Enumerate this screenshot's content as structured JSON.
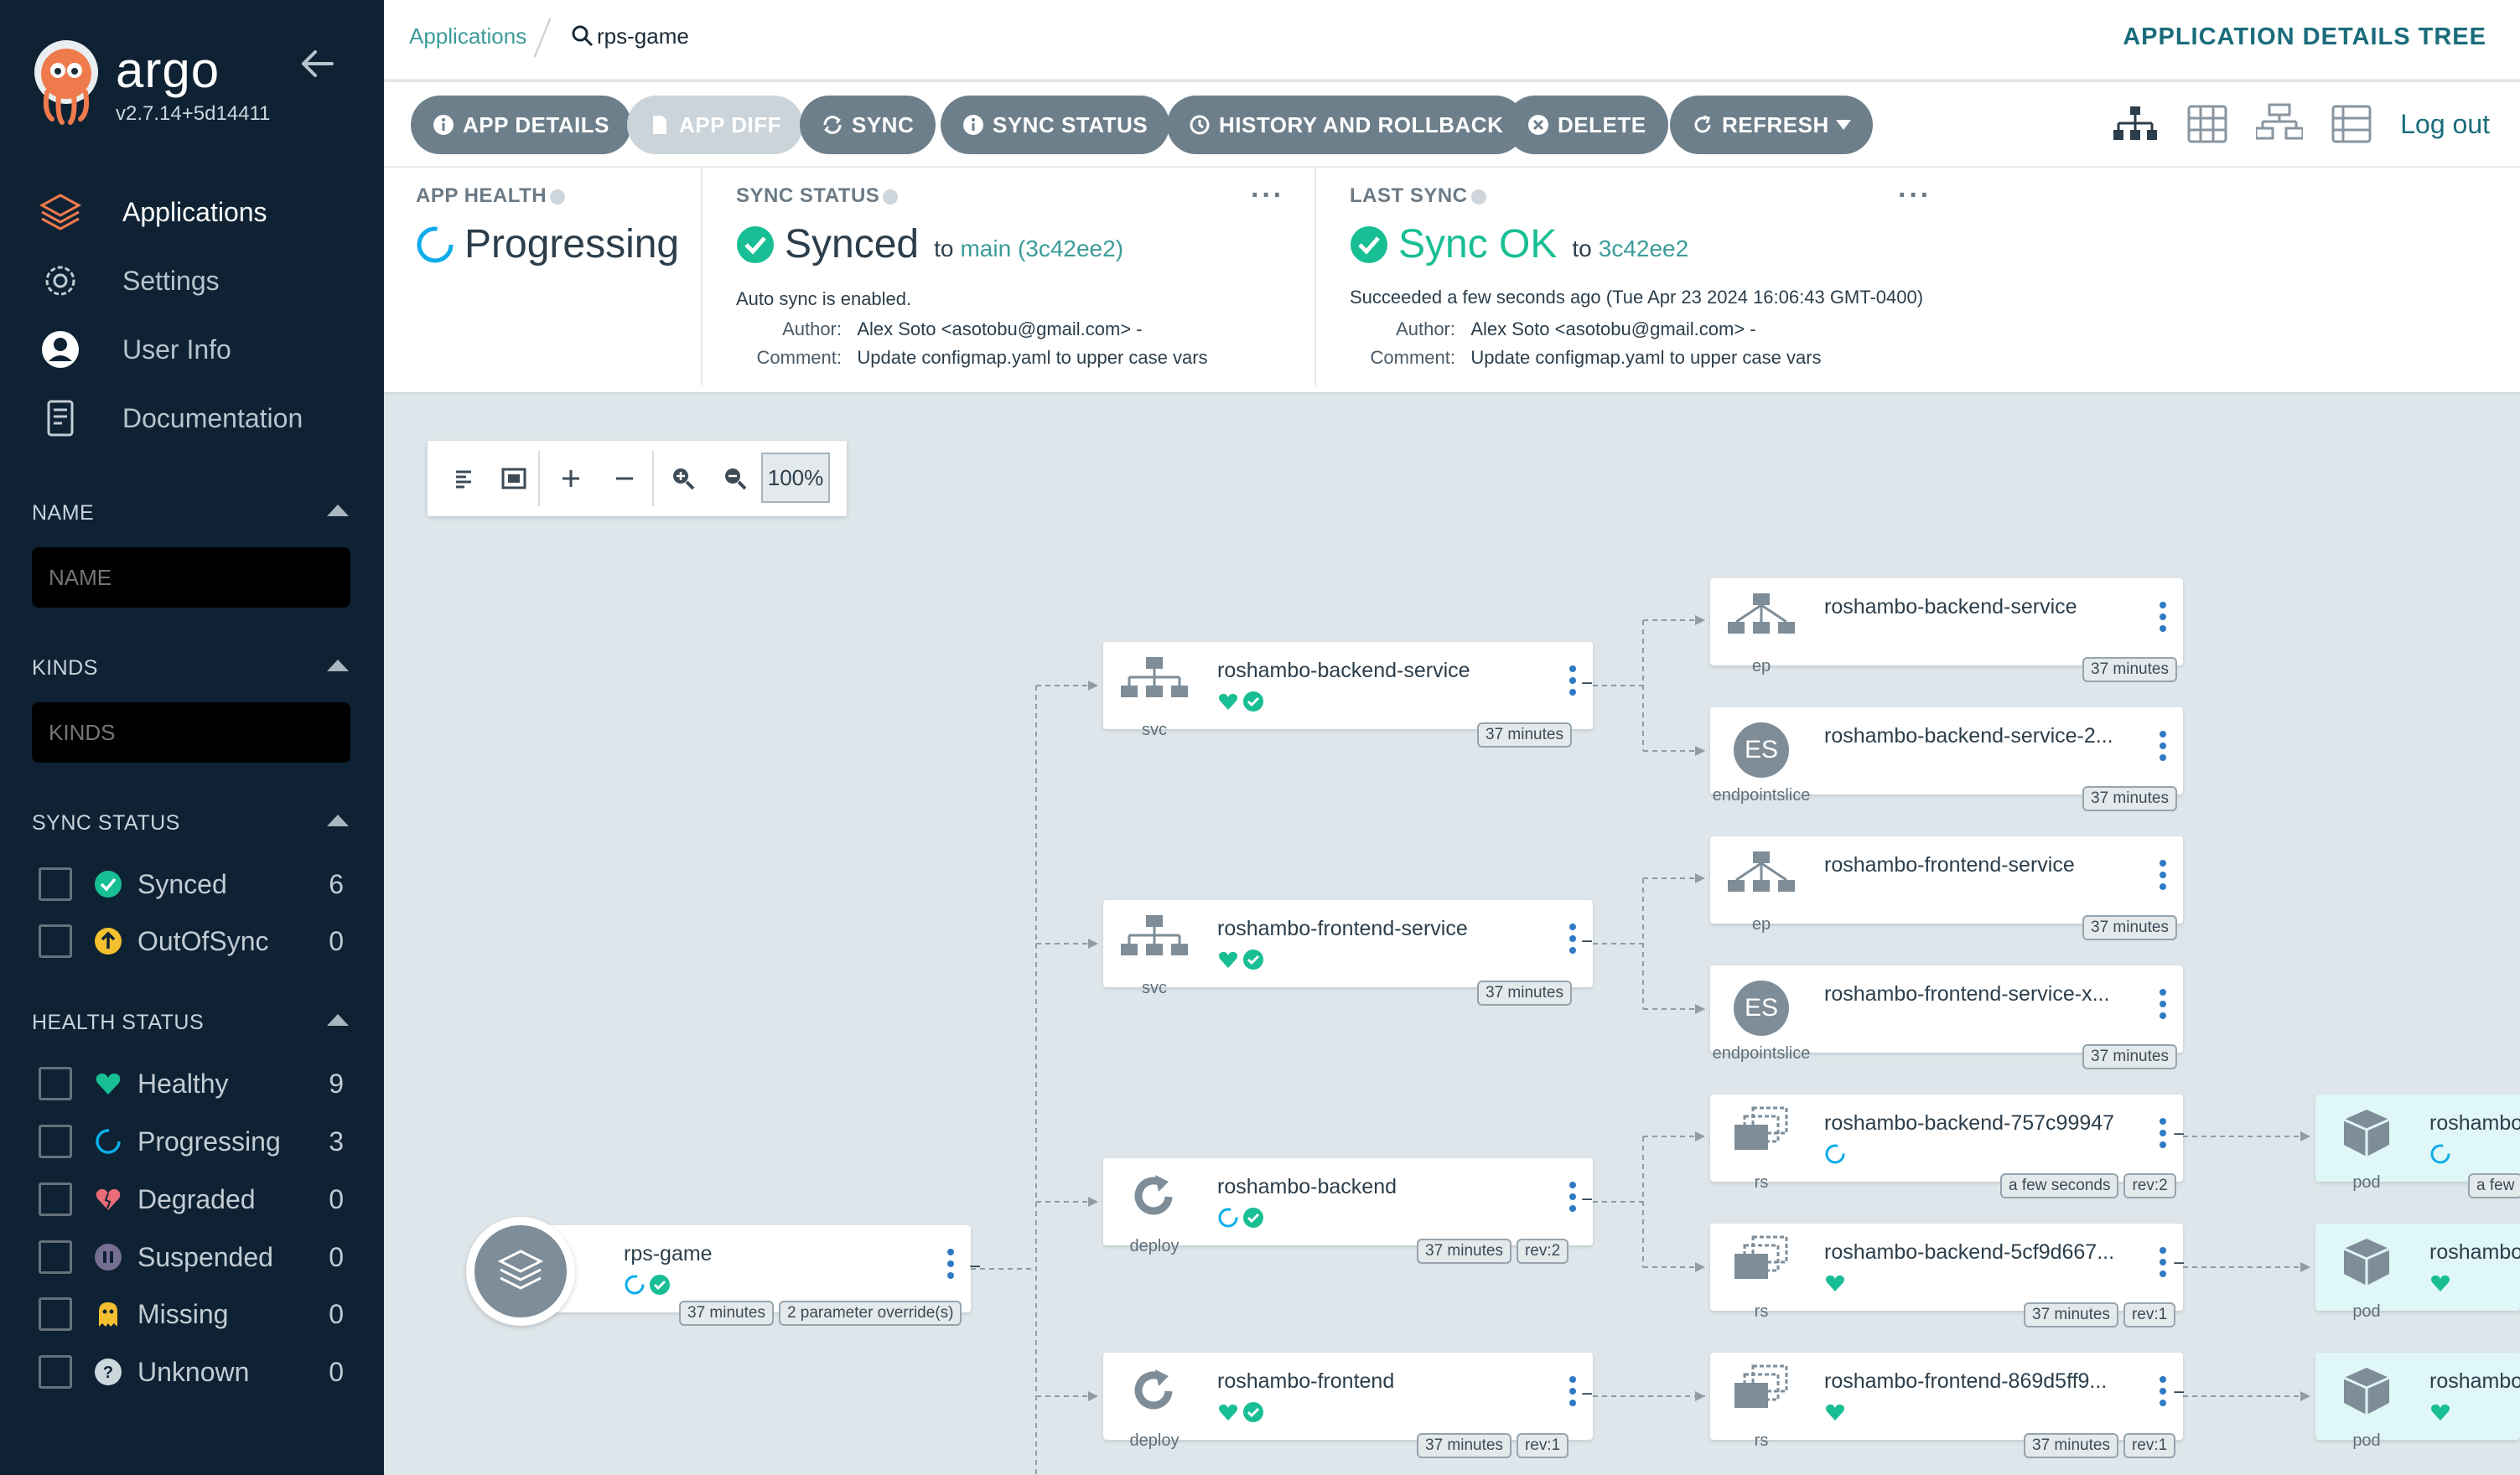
{
  "app": {
    "name": "argo",
    "version": "v2.7.14+5d14411"
  },
  "nav": [
    {
      "label": "Applications",
      "icon": "layers-icon"
    },
    {
      "label": "Settings",
      "icon": "gear-icon"
    },
    {
      "label": "User Info",
      "icon": "user-icon"
    },
    {
      "label": "Documentation",
      "icon": "book-icon"
    }
  ],
  "filters": {
    "name": {
      "title": "NAME",
      "placeholder": "NAME"
    },
    "kinds": {
      "title": "KINDS",
      "placeholder": "KINDS"
    },
    "sync_status": {
      "title": "SYNC STATUS",
      "items": [
        {
          "label": "Synced",
          "count": "6"
        },
        {
          "label": "OutOfSync",
          "count": "0"
        }
      ]
    },
    "health_status": {
      "title": "HEALTH STATUS",
      "items": [
        {
          "label": "Healthy",
          "count": "9"
        },
        {
          "label": "Progressing",
          "count": "3"
        },
        {
          "label": "Degraded",
          "count": "0"
        },
        {
          "label": "Suspended",
          "count": "0"
        },
        {
          "label": "Missing",
          "count": "0"
        },
        {
          "label": "Unknown",
          "count": "0"
        }
      ]
    }
  },
  "breadcrumb": {
    "root": "Applications",
    "current": "rps-game"
  },
  "page_title": "APPLICATION DETAILS TREE",
  "toolbar": {
    "app_details": "APP DETAILS",
    "app_diff": "APP DIFF",
    "sync": "SYNC",
    "sync_status": "SYNC STATUS",
    "history": "HISTORY AND ROLLBACK",
    "delete": "DELETE",
    "refresh": "REFRESH",
    "logout": "Log out"
  },
  "status": {
    "health": {
      "title": "APP HEALTH",
      "value": "Progressing"
    },
    "sync": {
      "title": "SYNC STATUS",
      "value": "Synced",
      "to": "to",
      "revision": "main (3c42ee2)",
      "auto": "Auto sync is enabled.",
      "author_label": "Author:",
      "author": "Alex Soto <asotobu@gmail.com> -",
      "comment_label": "Comment:",
      "comment": "Update configmap.yaml to upper case vars"
    },
    "last_sync": {
      "title": "LAST SYNC",
      "value": "Sync OK",
      "to": "to",
      "revision": "3c42ee2",
      "detail": "Succeeded a few seconds ago (Tue Apr 23 2024 16:06:43 GMT-0400)",
      "author_label": "Author:",
      "author": "Alex Soto <asotobu@gmail.com> -",
      "comment_label": "Comment:",
      "comment": "Update configmap.yaml to upper case vars"
    }
  },
  "zoom": {
    "level": "100%"
  },
  "tree": {
    "root": {
      "name": "rps-game",
      "tags": [
        "37 minutes",
        "2 parameter override(s)"
      ]
    },
    "nodes": [
      {
        "name": "roshambo-backend-service",
        "kind": "svc",
        "tags": [
          "37 minutes"
        ]
      },
      {
        "name": "roshambo-frontend-service",
        "kind": "svc",
        "tags": [
          "37 minutes"
        ]
      },
      {
        "name": "roshambo-backend",
        "kind": "deploy",
        "tags": [
          "37 minutes",
          "rev:2"
        ]
      },
      {
        "name": "roshambo-frontend",
        "kind": "deploy",
        "tags": [
          "37 minutes",
          "rev:1"
        ]
      },
      {
        "name": "roshambo-backend-service",
        "kind": "ep",
        "tags": [
          "37 minutes"
        ]
      },
      {
        "name": "roshambo-backend-service-2...",
        "kind": "endpointslice",
        "tags": [
          "37 minutes"
        ]
      },
      {
        "name": "roshambo-frontend-service",
        "kind": "ep",
        "tags": [
          "37 minutes"
        ]
      },
      {
        "name": "roshambo-frontend-service-x...",
        "kind": "endpointslice",
        "tags": [
          "37 minutes"
        ]
      },
      {
        "name": "roshambo-backend-757c99947",
        "kind": "rs",
        "tags": [
          "a few seconds",
          "rev:2"
        ]
      },
      {
        "name": "roshambo-backend-5cf9d667...",
        "kind": "rs",
        "tags": [
          "37 minutes",
          "rev:1"
        ]
      },
      {
        "name": "roshambo-frontend-869d5ff9...",
        "kind": "rs",
        "tags": [
          "37 minutes",
          "rev:1"
        ]
      },
      {
        "name": "roshambo",
        "kind": "pod",
        "tags": [
          "a few"
        ]
      },
      {
        "name": "roshambo",
        "kind": "pod",
        "tags": []
      },
      {
        "name": "roshambo",
        "kind": "pod",
        "tags": []
      }
    ],
    "es_label": "ES",
    "collapse": "−"
  },
  "colors": {
    "sidebar": "#0e2233",
    "accent": "#3b9c99",
    "synced": "#18be94",
    "progressing": "#0dadea",
    "degraded": "#e96d76",
    "outofsync": "#f4c030",
    "suspended": "#766f94"
  }
}
